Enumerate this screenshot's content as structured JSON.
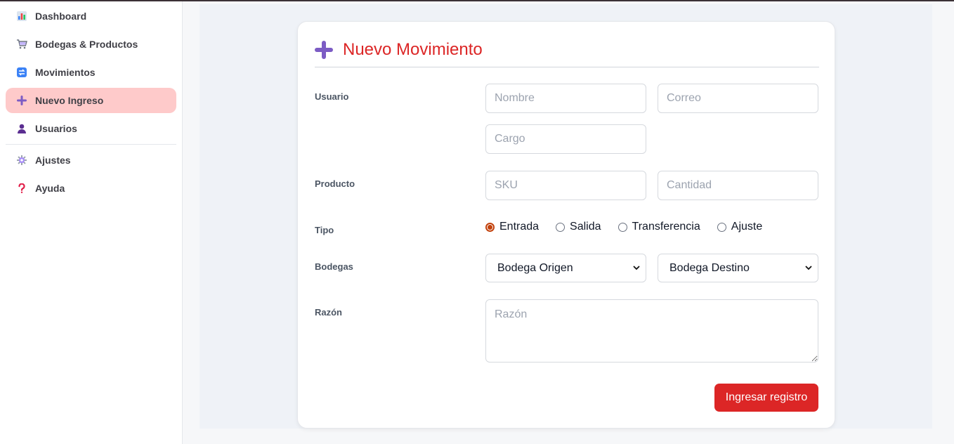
{
  "sidebar": {
    "items": [
      {
        "label": "Dashboard",
        "icon": "bar-chart-icon"
      },
      {
        "label": "Bodegas & Productos",
        "icon": "cart-icon"
      },
      {
        "label": "Movimientos",
        "icon": "exchange-icon"
      },
      {
        "label": "Nuevo Ingreso",
        "icon": "plus-icon",
        "active": true
      },
      {
        "label": "Usuarios",
        "icon": "user-icon"
      },
      {
        "label": "Ajustes",
        "icon": "gear-icon"
      },
      {
        "label": "Ayuda",
        "icon": "question-icon"
      }
    ]
  },
  "form": {
    "title": "Nuevo Movimiento",
    "labels": {
      "usuario": "Usuario",
      "producto": "Producto",
      "tipo": "Tipo",
      "bodegas": "Bodegas",
      "razon": "Razón"
    },
    "placeholders": {
      "nombre": "Nombre",
      "correo": "Correo",
      "cargo": "Cargo",
      "sku": "SKU",
      "cantidad": "Cantidad",
      "razon": "Razón"
    },
    "tipo_options": [
      "Entrada",
      "Salida",
      "Transferencia",
      "Ajuste"
    ],
    "tipo_selected": "Entrada",
    "bodega_origen": "Bodega Origen",
    "bodega_destino": "Bodega Destino",
    "submit_label": "Ingresar registro"
  },
  "colors": {
    "accent": "#dc2626",
    "active_nav_bg": "#fecaca",
    "plus_icon": "#7c5cc4"
  }
}
